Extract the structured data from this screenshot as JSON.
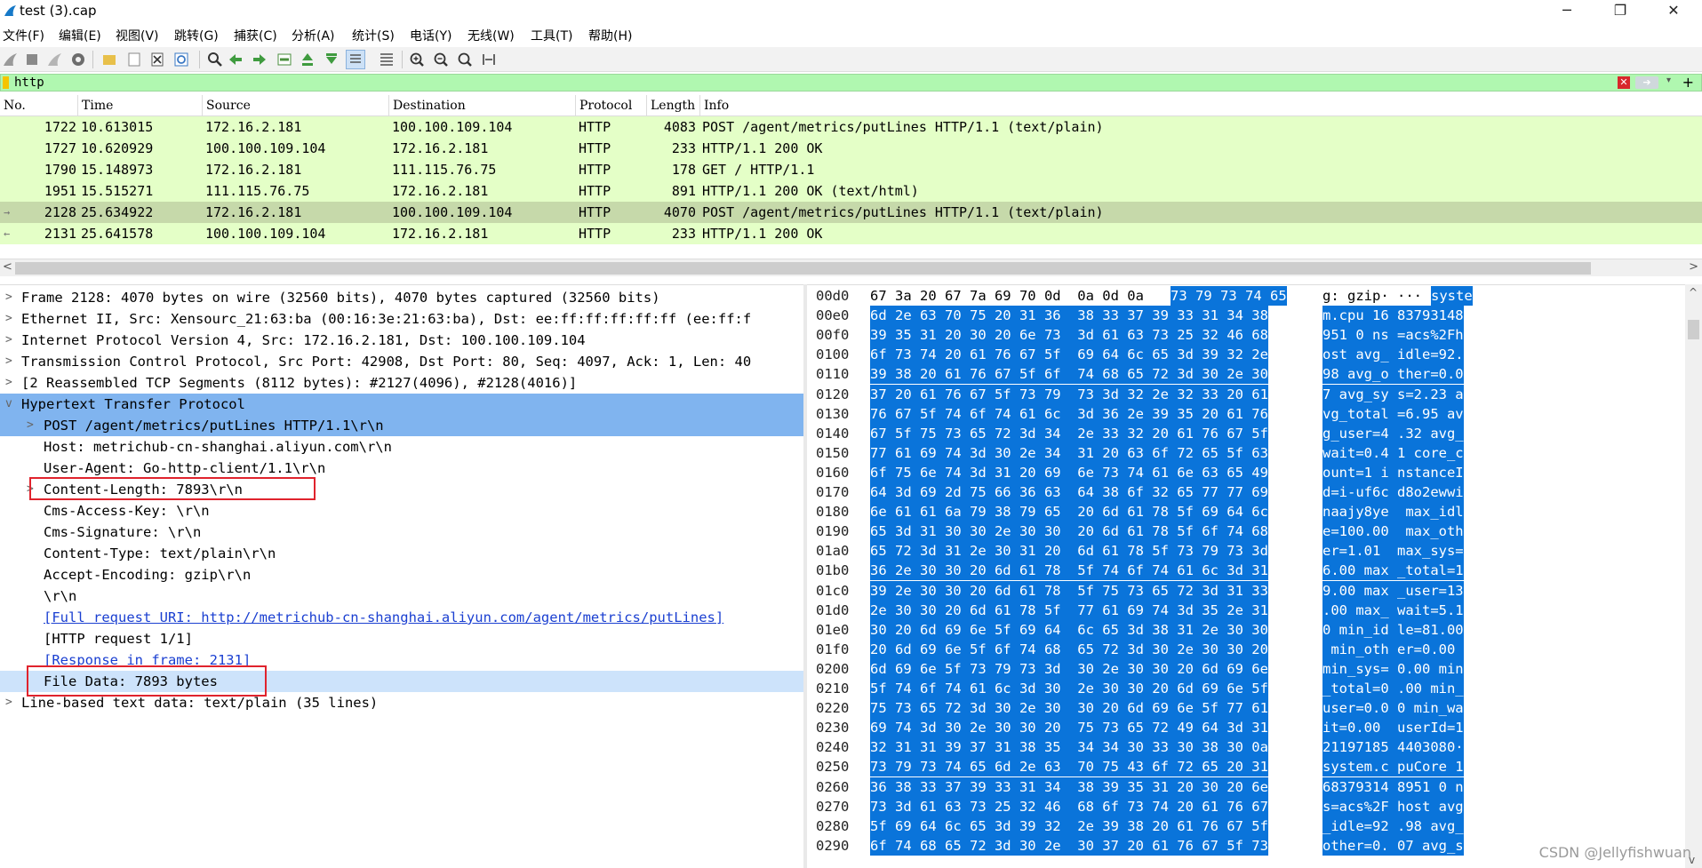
{
  "window": {
    "title": "test (3).cap",
    "minimize": "─",
    "maximize": "❐",
    "close": "✕"
  },
  "menu": [
    "文件(F)",
    "编辑(E)",
    "视图(V)",
    "跳转(G)",
    "捕获(C)",
    "分析(A)",
    "统计(S)",
    "电话(Y)",
    "无线(W)",
    "工具(T)",
    "帮助(H)"
  ],
  "toolbar_icons": [
    "shark-fin-start-icon",
    "stop-icon",
    "restart-icon",
    "options-gear-icon",
    "open-folder-icon",
    "file-icon",
    "close-file-icon",
    "reload-icon",
    "find-icon",
    "go-back-icon",
    "go-forward-icon",
    "go-to-packet-icon",
    "first-packet-icon",
    "last-packet-icon",
    "auto-scroll-icon",
    "colorize-icon",
    "zoom-in-icon",
    "zoom-out-icon",
    "zoom-normal-icon",
    "resize-columns-icon"
  ],
  "filter": {
    "value": "http",
    "clear_icon": "✕",
    "apply_icon": "➔",
    "dropdown_icon": "▾",
    "add_icon": "+"
  },
  "packet_list": {
    "columns": [
      "No.",
      "Time",
      "Source",
      "Destination",
      "Protocol",
      "Length",
      "Info"
    ],
    "rows": [
      {
        "no": "1722",
        "time": "10.613015",
        "src": "172.16.2.181",
        "dst": "100.100.109.104",
        "proto": "HTTP",
        "len": "4083",
        "info": "POST /agent/metrics/putLines HTTP/1.1  (text/plain)"
      },
      {
        "no": "1727",
        "time": "10.620929",
        "src": "100.100.109.104",
        "dst": "172.16.2.181",
        "proto": "HTTP",
        "len": "233",
        "info": "HTTP/1.1 200 OK"
      },
      {
        "no": "1790",
        "time": "15.148973",
        "src": "172.16.2.181",
        "dst": "111.115.76.75",
        "proto": "HTTP",
        "len": "178",
        "info": "GET / HTTP/1.1"
      },
      {
        "no": "1951",
        "time": "15.515271",
        "src": "111.115.76.75",
        "dst": "172.16.2.181",
        "proto": "HTTP",
        "len": "891",
        "info": "HTTP/1.1 200 OK  (text/html)"
      },
      {
        "no": "2128",
        "time": "25.634922",
        "src": "172.16.2.181",
        "dst": "100.100.109.104",
        "proto": "HTTP",
        "len": "4070",
        "info": "POST /agent/metrics/putLines HTTP/1.1  (text/plain)"
      },
      {
        "no": "2131",
        "time": "25.641578",
        "src": "100.100.109.104",
        "dst": "172.16.2.181",
        "proto": "HTTP",
        "len": "233",
        "info": "HTTP/1.1 200 OK"
      }
    ],
    "selected_no": "2128",
    "related_markers": [
      "→",
      "←"
    ]
  },
  "scroll_arrows": {
    "left": "<",
    "right": ">",
    "up": "^",
    "down": "v"
  },
  "details": [
    {
      "twisty": ">",
      "text": "Frame 2128: 4070 bytes on wire (32560 bits), 4070 bytes captured (32560 bits)"
    },
    {
      "twisty": ">",
      "text": "Ethernet II, Src: Xensourc_21:63:ba (00:16:3e:21:63:ba), Dst: ee:ff:ff:ff:ff:ff (ee:ff:f"
    },
    {
      "twisty": ">",
      "text": "Internet Protocol Version 4, Src: 172.16.2.181, Dst: 100.100.109.104"
    },
    {
      "twisty": ">",
      "text": "Transmission Control Protocol, Src Port: 42908, Dst Port: 80, Seq: 4097, Ack: 1, Len: 40"
    },
    {
      "twisty": ">",
      "text": "[2 Reassembled TCP Segments (8112 bytes): #2127(4096), #2128(4016)]"
    },
    {
      "twisty": "v",
      "text": "Hypertext Transfer Protocol"
    },
    {
      "twisty": ">",
      "text": "POST /agent/metrics/putLines HTTP/1.1\\r\\n"
    },
    {
      "twisty": "",
      "text": "Host: metrichub-cn-shanghai.aliyun.com\\r\\n"
    },
    {
      "twisty": "",
      "text": "User-Agent: Go-http-client/1.1\\r\\n"
    },
    {
      "twisty": ">",
      "text": "Content-Length: 7893\\r\\n"
    },
    {
      "twisty": "",
      "text": "Cms-Access-Key: \\r\\n"
    },
    {
      "twisty": "",
      "text": "Cms-Signature: \\r\\n"
    },
    {
      "twisty": "",
      "text": "Content-Type: text/plain\\r\\n"
    },
    {
      "twisty": "",
      "text": "Accept-Encoding: gzip\\r\\n"
    },
    {
      "twisty": "",
      "text": "\\r\\n"
    },
    {
      "twisty": "",
      "text": "[Full request URI: http://metrichub-cn-shanghai.aliyun.com/agent/metrics/putLines]"
    },
    {
      "twisty": "",
      "text": "[HTTP request 1/1]"
    },
    {
      "twisty": "",
      "text": "[Response in frame: 2131]"
    },
    {
      "twisty": "",
      "text": "File Data: 7893 bytes"
    },
    {
      "twisty": ">",
      "text": "Line-based text data: text/plain (35 lines)"
    }
  ],
  "bytes": [
    {
      "off": "00d0",
      "h1": "67 3a 20 67 7a 69 70 0d  0a 0d 0a",
      "h2": "73 79 73 74 65",
      "a1": "g: gzip· ···",
      "a2": "syste"
    },
    {
      "off": "00e0",
      "h1": "",
      "h2": "6d 2e 63 70 75 20 31 36  38 33 37 39 33 31 34 38",
      "a1": "",
      "a2": "m.cpu 16 83793148"
    },
    {
      "off": "00f0",
      "h1": "",
      "h2": "39 35 31 20 30 20 6e 73  3d 61 63 73 25 32 46 68",
      "a1": "",
      "a2": "951 0 ns =acs%2Fh"
    },
    {
      "off": "0100",
      "h1": "",
      "h2": "6f 73 74 20 61 76 67 5f  69 64 6c 65 3d 39 32 2e",
      "a1": "",
      "a2": "ost avg_ idle=92."
    },
    {
      "off": "0110",
      "h1": "",
      "h2": "39 38 20 61 76 67 5f 6f  74 68 65 72 3d 30 2e 30",
      "a1": "",
      "a2": "98 avg_o ther=0.0"
    },
    {
      "off": "0120",
      "h1": "",
      "h2": "37 20 61 76 67 5f 73 79  73 3d 32 2e 32 33 20 61",
      "a1": "",
      "a2": "7 avg_sy s=2.23 a"
    },
    {
      "off": "0130",
      "h1": "",
      "h2": "76 67 5f 74 6f 74 61 6c  3d 36 2e 39 35 20 61 76",
      "a1": "",
      "a2": "vg_total =6.95 av"
    },
    {
      "off": "0140",
      "h1": "",
      "h2": "67 5f 75 73 65 72 3d 34  2e 33 32 20 61 76 67 5f",
      "a1": "",
      "a2": "g_user=4 .32 avg_"
    },
    {
      "off": "0150",
      "h1": "",
      "h2": "77 61 69 74 3d 30 2e 34  31 20 63 6f 72 65 5f 63",
      "a1": "",
      "a2": "wait=0.4 1 core_c"
    },
    {
      "off": "0160",
      "h1": "",
      "h2": "6f 75 6e 74 3d 31 20 69  6e 73 74 61 6e 63 65 49",
      "a1": "",
      "a2": "ount=1 i nstanceI"
    },
    {
      "off": "0170",
      "h1": "",
      "h2": "64 3d 69 2d 75 66 36 63  64 38 6f 32 65 77 77 69",
      "a1": "",
      "a2": "d=i-uf6c d8o2ewwi"
    },
    {
      "off": "0180",
      "h1": "",
      "h2": "6e 61 61 6a 79 38 79 65  20 6d 61 78 5f 69 64 6c",
      "a1": "",
      "a2": "naajy8ye  max_idl"
    },
    {
      "off": "0190",
      "h1": "",
      "h2": "65 3d 31 30 30 2e 30 30  20 6d 61 78 5f 6f 74 68",
      "a1": "",
      "a2": "e=100.00  max_oth"
    },
    {
      "off": "01a0",
      "h1": "",
      "h2": "65 72 3d 31 2e 30 31 20  6d 61 78 5f 73 79 73 3d",
      "a1": "",
      "a2": "er=1.01  max_sys="
    },
    {
      "off": "01b0",
      "h1": "",
      "h2": "36 2e 30 30 20 6d 61 78  5f 74 6f 74 61 6c 3d 31",
      "a1": "",
      "a2": "6.00 max _total=1"
    },
    {
      "off": "01c0",
      "h1": "",
      "h2": "39 2e 30 30 20 6d 61 78  5f 75 73 65 72 3d 31 33",
      "a1": "",
      "a2": "9.00 max _user=13"
    },
    {
      "off": "01d0",
      "h1": "",
      "h2": "2e 30 30 20 6d 61 78 5f  77 61 69 74 3d 35 2e 31",
      "a1": "",
      "a2": ".00 max_ wait=5.1"
    },
    {
      "off": "01e0",
      "h1": "",
      "h2": "30 20 6d 69 6e 5f 69 64  6c 65 3d 38 31 2e 30 30",
      "a1": "",
      "a2": "0 min_id le=81.00"
    },
    {
      "off": "01f0",
      "h1": "",
      "h2": "20 6d 69 6e 5f 6f 74 68  65 72 3d 30 2e 30 30 20",
      "a1": "",
      "a2": " min_oth er=0.00 "
    },
    {
      "off": "0200",
      "h1": "",
      "h2": "6d 69 6e 5f 73 79 73 3d  30 2e 30 30 20 6d 69 6e",
      "a1": "",
      "a2": "min_sys= 0.00 min"
    },
    {
      "off": "0210",
      "h1": "",
      "h2": "5f 74 6f 74 61 6c 3d 30  2e 30 30 20 6d 69 6e 5f",
      "a1": "",
      "a2": "_total=0 .00 min_"
    },
    {
      "off": "0220",
      "h1": "",
      "h2": "75 73 65 72 3d 30 2e 30  30 20 6d 69 6e 5f 77 61",
      "a1": "",
      "a2": "user=0.0 0 min_wa"
    },
    {
      "off": "0230",
      "h1": "",
      "h2": "69 74 3d 30 2e 30 30 20  75 73 65 72 49 64 3d 31",
      "a1": "",
      "a2": "it=0.00  userId=1"
    },
    {
      "off": "0240",
      "h1": "",
      "h2": "32 31 31 39 37 31 38 35  34 34 30 33 30 38 30 0a",
      "a1": "",
      "a2": "21197185 4403080·"
    },
    {
      "off": "0250",
      "h1": "",
      "h2": "73 79 73 74 65 6d 2e 63  70 75 43 6f 72 65 20 31",
      "a1": "",
      "a2": "system.c puCore 1"
    },
    {
      "off": "0260",
      "h1": "",
      "h2": "36 38 33 37 39 33 31 34  38 39 35 31 20 30 20 6e",
      "a1": "",
      "a2": "68379314 8951 0 n"
    },
    {
      "off": "0270",
      "h1": "",
      "h2": "73 3d 61 63 73 25 32 46  68 6f 73 74 20 61 76 67",
      "a1": "",
      "a2": "s=acs%2F host avg"
    },
    {
      "off": "0280",
      "h1": "",
      "h2": "5f 69 64 6c 65 3d 39 32  2e 39 38 20 61 76 67 5f",
      "a1": "",
      "a2": "_idle=92 .98 avg_"
    },
    {
      "off": "0290",
      "h1": "",
      "h2": "6f 74 68 65 72 3d 30 2e  30 37 20 61 76 67 5f 73",
      "a1": "",
      "a2": "other=0. 07 avg_s"
    }
  ],
  "watermark": "CSDN @Jellyfishwuan",
  "colors": {
    "filter_ok": "#b0f7b0",
    "http_row": "#e4ffc7",
    "selected_row": "#c6d9aa",
    "tree_highlight": "#80b4ef",
    "bytes_highlight": "#0a74da",
    "annotation_box": "#e0232d"
  }
}
